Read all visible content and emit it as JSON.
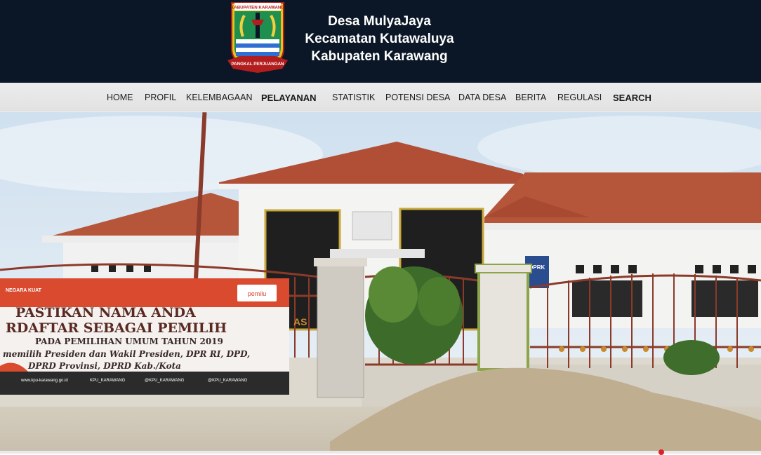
{
  "header": {
    "logo": {
      "icon": "kabupaten-karawang-emblem-icon",
      "top_text": "KABUPATEN KARAWANG",
      "ribbon_text": "PANGKAL PERJUANGAN"
    },
    "title_line1": "Desa MulyaJaya",
    "title_line2": "Kecamatan Kutawaluya",
    "title_line3": "Kabupaten Karawang"
  },
  "nav": {
    "items": [
      {
        "label": "HOME"
      },
      {
        "label": "PROFIL"
      },
      {
        "label": "KELEMBAGAAN"
      },
      {
        "label": "PELAYANAN"
      },
      {
        "label": "STATISTIK"
      },
      {
        "label": "POTENSI DESA"
      },
      {
        "label": "DATA DESA"
      },
      {
        "label": "BERITA"
      },
      {
        "label": "REGULASI"
      },
      {
        "label": "SEARCH"
      }
    ]
  },
  "hero": {
    "banner": {
      "logo_left": "NEGARA KUAT",
      "logo_right": "pemilu",
      "line1": "PASTIKAN NAMA ANDA",
      "line2": "RDAFTAR SEBAGAI PEMILIH",
      "line3": "PADA PEMILIHAN UMUM TAHUN 2019",
      "line4": "memilih Presiden dan Wakil Presiden, DPR RI, DPD,",
      "line5": "DPRD Provinsi, DPRD Kab./Kota",
      "footer1": "www.kpu-karawang.go.id",
      "footer2": "KPU_KARAWANG",
      "footer3": "@KPU_KARAWANG",
      "footer4": "@KPU_KARAWANG"
    },
    "plaque_text": "DPRK",
    "wall_letters": "AS"
  },
  "colors": {
    "header_bg": "#0b1726",
    "nav_bg": "#e6e6e6",
    "roof": "#b5553a",
    "banner_red": "#d94a2f"
  }
}
